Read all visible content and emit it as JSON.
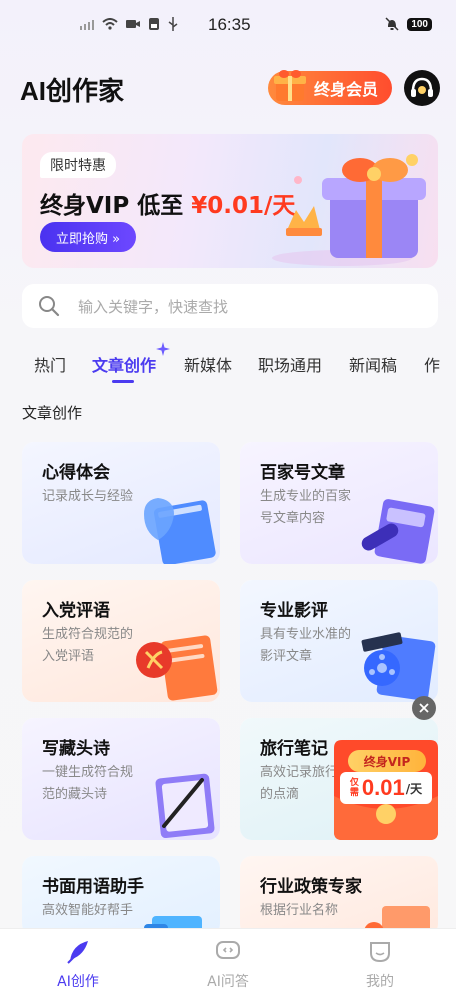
{
  "status_bar": {
    "time": "16:35",
    "battery": "100"
  },
  "header": {
    "title": "AI创作家",
    "vip_button": "终身会员"
  },
  "banner": {
    "tag": "限时特惠",
    "title_prefix": "终身VIP 低至",
    "price": "¥0.01/天",
    "cta": "立即抢购 »"
  },
  "search": {
    "placeholder": "输入关键字，快速查找"
  },
  "tabs": [
    {
      "label": "热门"
    },
    {
      "label": "文章创作",
      "active": true
    },
    {
      "label": "新媒体"
    },
    {
      "label": "职场通用"
    },
    {
      "label": "新闻稿"
    },
    {
      "label": "作"
    }
  ],
  "section_title": "文章创作",
  "cards": [
    {
      "name": "心得体会",
      "desc": "记录成长与经验",
      "icon": "blue-shield-doc-icon"
    },
    {
      "name": "百家号文章",
      "desc": "生成专业的百家号文章内容",
      "icon": "pen-doc-icon"
    },
    {
      "name": "入党评语",
      "desc": "生成符合规范的入党评语",
      "icon": "party-emblem-doc-icon"
    },
    {
      "name": "专业影评",
      "desc": "具有专业水准的影评文章",
      "icon": "film-reel-doc-icon"
    },
    {
      "name": "写藏头诗",
      "desc": "一键生成符合规范的藏头诗",
      "icon": "brush-doc-icon"
    },
    {
      "name": "旅行笔记",
      "desc": "高效记录旅行中的点滴",
      "icon": "travel-doc-icon"
    },
    {
      "name": "书面用语助手",
      "desc": "高效智能好帮手",
      "icon": "book-icon"
    },
    {
      "name": "行业政策专家",
      "desc": "根据行业名称",
      "icon": "policy-doc-icon"
    }
  ],
  "floating_promo": {
    "label": "终身VIP",
    "prefix": "仅需",
    "price": "0.01",
    "unit": "/天"
  },
  "bottom_nav": [
    {
      "label": "AI创作",
      "active": true
    },
    {
      "label": "AI问答"
    },
    {
      "label": "我的"
    }
  ],
  "colors": {
    "accent": "#4b3bf0",
    "promo_red": "#ff3a1f",
    "vip_orange": "#ff6a35"
  }
}
